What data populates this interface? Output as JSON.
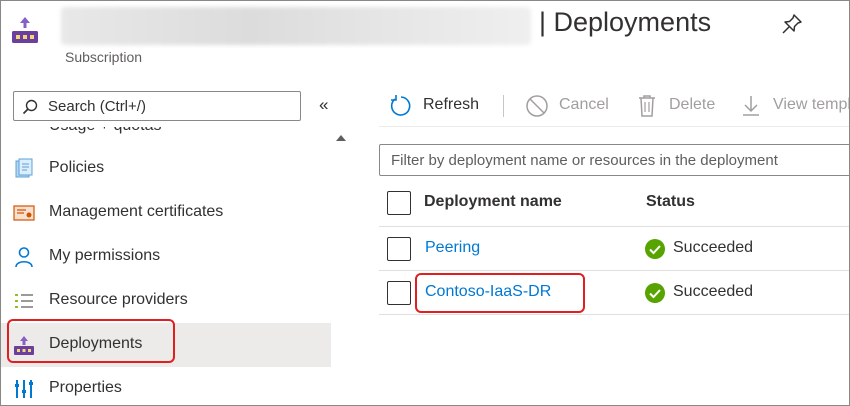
{
  "header": {
    "title": "| Deployments",
    "subtitle": "Subscription",
    "resource_icon": "subscription-icon",
    "pin_icon": "pin-icon"
  },
  "sidebar": {
    "search_placeholder": "Search (Ctrl+/)",
    "collapse_label": "«",
    "items": [
      {
        "label": "Usage + quotas",
        "icon": "usage-icon"
      },
      {
        "label": "Policies",
        "icon": "policies-icon"
      },
      {
        "label": "Management certificates",
        "icon": "certificate-icon"
      },
      {
        "label": "My permissions",
        "icon": "person-icon"
      },
      {
        "label": "Resource providers",
        "icon": "list-icon"
      },
      {
        "label": "Deployments",
        "icon": "deployments-icon",
        "selected": true
      },
      {
        "label": "Properties",
        "icon": "properties-icon"
      }
    ]
  },
  "toolbar": {
    "refresh": "Refresh",
    "cancel": "Cancel",
    "delete": "Delete",
    "view_template": "View template"
  },
  "filter": {
    "placeholder": "Filter by deployment name or resources in the deployment"
  },
  "table": {
    "columns": [
      "Deployment name",
      "Status"
    ],
    "rows": [
      {
        "name": "Peering",
        "status": "Succeeded"
      },
      {
        "name": "Contoso-IaaS-DR",
        "status": "Succeeded"
      }
    ]
  },
  "colors": {
    "accent": "#0078d4",
    "success": "#57a300",
    "highlight": "#e02020",
    "selected_bg": "#edebe9"
  }
}
